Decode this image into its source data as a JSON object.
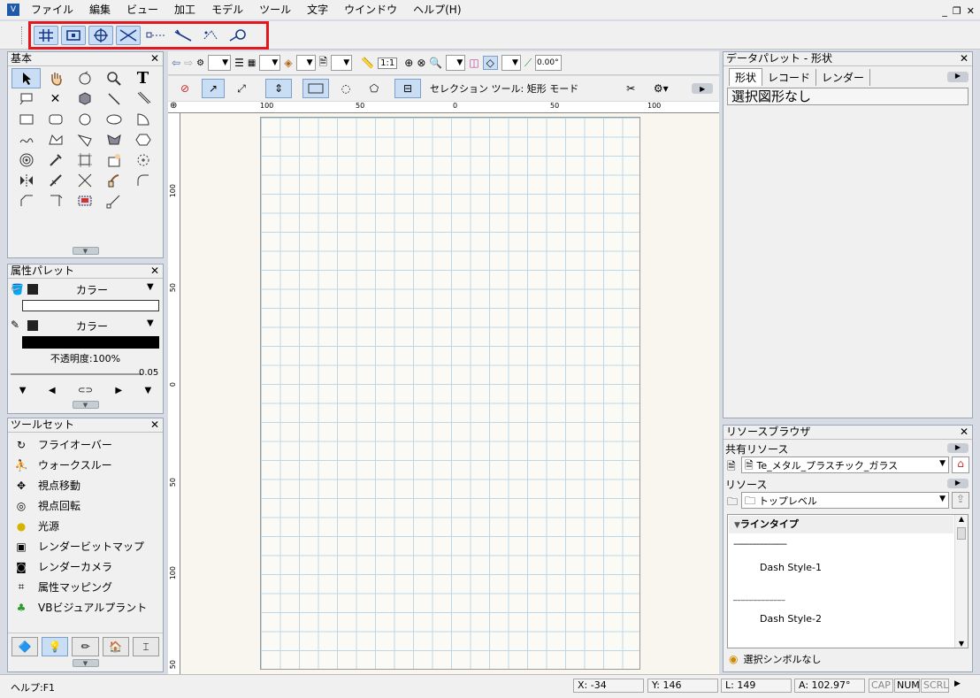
{
  "app_icon": "vectorworks-icon",
  "menu": [
    "ファイル",
    "編集",
    "ビュー",
    "加工",
    "モデル",
    "ツール",
    "文字",
    "ウインドウ",
    "ヘルプ(H)"
  ],
  "window_controls": [
    "_",
    "❐",
    "✕"
  ],
  "snap_buttons": [
    {
      "name": "snap-grid-icon",
      "active": true
    },
    {
      "name": "snap-object-icon",
      "active": true
    },
    {
      "name": "snap-angle-icon",
      "active": true
    },
    {
      "name": "snap-intersection-icon",
      "active": true
    },
    {
      "name": "snap-distance-icon",
      "active": false
    },
    {
      "name": "snap-tangent-icon",
      "active": false
    },
    {
      "name": "snap-surface-icon",
      "active": false
    },
    {
      "name": "snap-edge-icon",
      "active": false
    }
  ],
  "basic_palette": {
    "title": "基本",
    "close": "✕"
  },
  "attr_palette": {
    "title": "属性パレット",
    "close": "✕",
    "fill_label": "カラー",
    "pen_label": "カラー",
    "opacity": "不透明度:100%",
    "line_weight": "0.05"
  },
  "toolset": {
    "title": "ツールセット",
    "close": "✕",
    "items": [
      "フライオーバー",
      "ウォークスルー",
      "視点移動",
      "視点回転",
      "光源",
      "レンダービットマップ",
      "レンダーカメラ",
      "属性マッピング",
      "VBビジュアルプラント"
    ]
  },
  "toolbar": {
    "scale": "1:1",
    "angle": "0.00°"
  },
  "mode_bar": {
    "label": "セレクション ツール: 矩形 モード"
  },
  "ruler_h": [
    "100",
    "50",
    "0",
    "50",
    "100"
  ],
  "ruler_v": [
    "100",
    "50",
    "0",
    "50",
    "100",
    "50"
  ],
  "data_palette": {
    "title": "データパレット - 形状",
    "close": "✕",
    "tabs": [
      "形状",
      "レコード",
      "レンダー"
    ],
    "message": "選択図形なし"
  },
  "resource_browser": {
    "title": "リソースブラウザ",
    "close": "✕",
    "shared_label": "共有リソース",
    "shared_value": "Te_メタル_プラスチック_ガラス",
    "resource_label": "リソース",
    "resource_value": "トップレベル",
    "section": "ラインタイプ",
    "items": [
      "Dash Style-1",
      "Dash Style-2"
    ],
    "dash1": "-----------------------",
    "dash2": "_ _ _ _ _ _ _ _ _ _ _ _ _",
    "footer": "選択シンボルなし"
  },
  "status": {
    "help": "ヘルプ:F1",
    "x": "X: -34",
    "y": "Y: 146",
    "l": "L: 149",
    "a": "A: 102.97°",
    "caps": "CAP",
    "num": "NUM",
    "scrl": "SCRL"
  },
  "colors": {
    "highlight": "#e3181f",
    "active_btn": "#c9def5",
    "grid": "#bcd8e8",
    "canvas": "#f8f6ee"
  }
}
